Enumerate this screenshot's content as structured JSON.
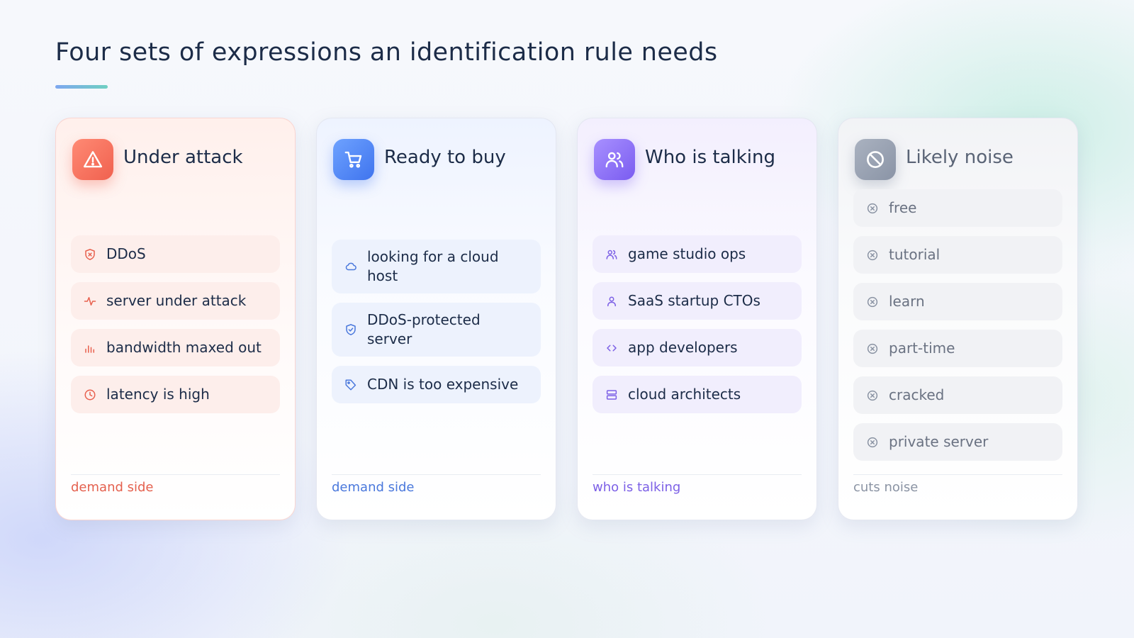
{
  "header": {
    "title": "Four sets of expressions an identification rule needs"
  },
  "colors": {
    "red": "#f0614f",
    "blue": "#3f74ee",
    "purple": "#7a5cf0",
    "gray": "#8a94a6"
  },
  "cards": [
    {
      "title": "Under attack",
      "icon": "warning-triangle-icon",
      "footer": "demand side",
      "items": [
        {
          "label": "DDoS",
          "icon": "shield-x-icon"
        },
        {
          "label": "server under attack",
          "icon": "activity-pulse-icon"
        },
        {
          "label": "bandwidth maxed out",
          "icon": "bar-chart-icon"
        },
        {
          "label": "latency is high",
          "icon": "clock-icon"
        }
      ]
    },
    {
      "title": "Ready to buy",
      "icon": "shopping-cart-icon",
      "footer": "demand side",
      "items": [
        {
          "label": "looking for a cloud host",
          "icon": "cloud-icon"
        },
        {
          "label": "DDoS-protected server",
          "icon": "shield-check-icon"
        },
        {
          "label": "CDN is too expensive",
          "icon": "price-tag-icon"
        }
      ]
    },
    {
      "title": "Who is talking",
      "icon": "users-icon",
      "footer": "who is talking",
      "items": [
        {
          "label": "game studio ops",
          "icon": "users-icon"
        },
        {
          "label": "SaaS startup CTOs",
          "icon": "user-icon"
        },
        {
          "label": "app developers",
          "icon": "code-icon"
        },
        {
          "label": "cloud architects",
          "icon": "server-icon"
        }
      ]
    },
    {
      "title": "Likely noise",
      "icon": "ban-icon",
      "footer": "cuts noise",
      "items": [
        {
          "label": "free",
          "icon": "x-circle-icon"
        },
        {
          "label": "tutorial",
          "icon": "x-circle-icon"
        },
        {
          "label": "learn",
          "icon": "x-circle-icon"
        },
        {
          "label": "part-time",
          "icon": "x-circle-icon"
        },
        {
          "label": "cracked",
          "icon": "x-circle-icon"
        },
        {
          "label": "private server",
          "icon": "x-circle-icon"
        }
      ]
    }
  ]
}
